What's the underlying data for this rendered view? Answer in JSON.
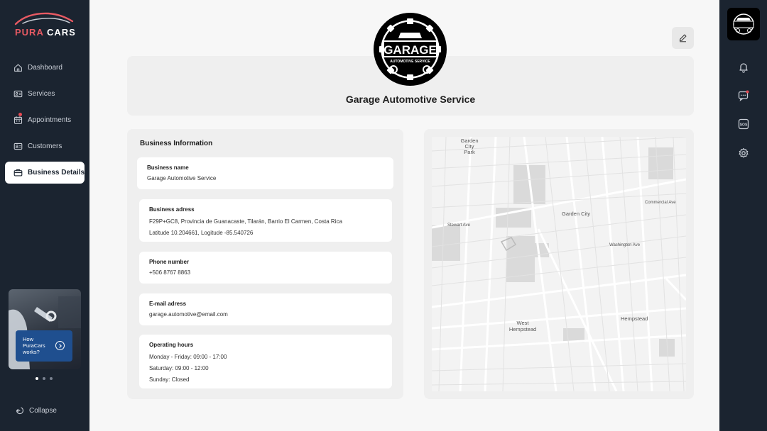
{
  "brand": {
    "word1": "PURA",
    "word2": "CARS"
  },
  "nav": {
    "items": [
      {
        "label": "Dashboard",
        "icon": "home-icon"
      },
      {
        "label": "Services",
        "icon": "id-card-icon"
      },
      {
        "label": "Appointments",
        "icon": "calendar-icon"
      },
      {
        "label": "Customers",
        "icon": "contact-card-icon"
      },
      {
        "label": "Business Details",
        "icon": "briefcase-icon",
        "active": true
      }
    ]
  },
  "promo": {
    "text": "How PuraCars works?"
  },
  "collapse_label": "Collapse",
  "business": {
    "name": "Garage Automotive Service"
  },
  "info": {
    "title": "Business Information",
    "fields": [
      {
        "label": "Business name",
        "lines": [
          "Garage Automotive Service"
        ]
      },
      {
        "label": "Business adress",
        "lines": [
          "F29P+GC8, Provincia de Guanacaste, Tilarán, Barrio El Carmen, Costa Rica",
          "Latitude 10.204661,  Logitude -85.540726"
        ]
      },
      {
        "label": "Phone number",
        "lines": [
          "+506 8767 8863"
        ]
      },
      {
        "label": "E-mail adress",
        "lines": [
          "garage.automotive@email.com"
        ]
      },
      {
        "label": "Operating hours",
        "lines": [
          "Monday - Friday: 09:00 - 17:00",
          "Saturday: 09:00 - 12:00",
          "Sunday: Closed"
        ]
      }
    ]
  },
  "logo_text": {
    "main": "GARAGE",
    "sub": "AUTOMOTIVE SERVICE"
  },
  "map": {
    "labels": [
      "Garden City Park",
      "Garden City",
      "West Hempstead",
      "Hempstead",
      "Stewart Ave",
      "Commercial Ave",
      "Washington Ave"
    ]
  },
  "colors": {
    "sidebar": "#1b2430",
    "accent_red": "#e84a53",
    "promo_blue": "#1f4f8f"
  }
}
